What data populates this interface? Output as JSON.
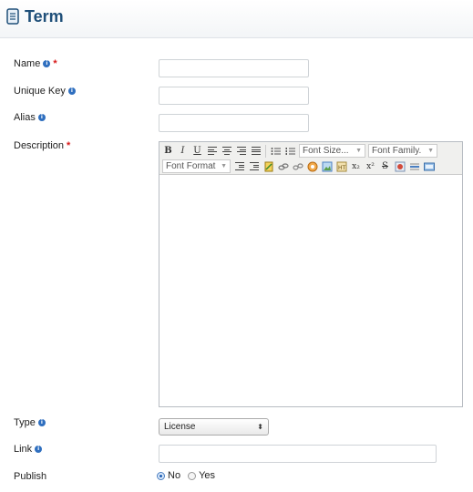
{
  "header": {
    "title": "Term"
  },
  "form": {
    "name": {
      "label": "Name",
      "value": ""
    },
    "unique_key": {
      "label": "Unique Key",
      "value": ""
    },
    "alias": {
      "label": "Alias",
      "value": ""
    },
    "description": {
      "label": "Description"
    },
    "type": {
      "label": "Type",
      "selected": "License"
    },
    "link": {
      "label": "Link",
      "value": ""
    },
    "publish": {
      "label": "Publish",
      "options": [
        "No",
        "Yes"
      ],
      "selected": "No"
    },
    "required_marker": "*"
  },
  "editor": {
    "font_size_placeholder": "Font Size...",
    "font_family_placeholder": "Font Family.",
    "font_format_placeholder": "Font Format",
    "buttons": {
      "bold": "B",
      "italic": "I",
      "underline": "U",
      "subscript": "x₂",
      "superscript": "x²",
      "strikethrough": "S"
    }
  },
  "colors": {
    "accent": "#1f4f79",
    "required": "#d81c1c",
    "info": "#2f6fbf"
  }
}
